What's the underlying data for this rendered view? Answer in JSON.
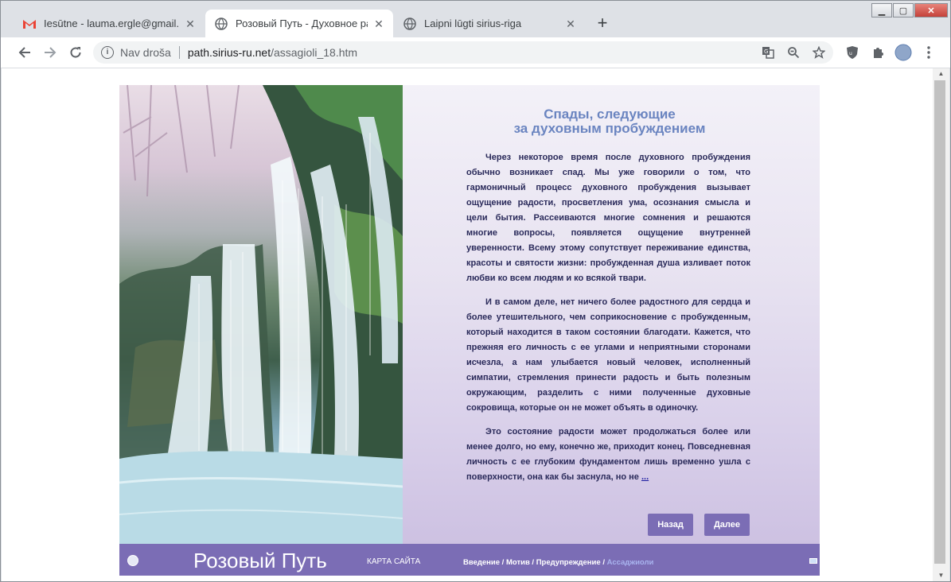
{
  "tabs": [
    {
      "title": "Iesūtne - lauma.ergle@gmail.com",
      "icon": "gmail-icon",
      "active": false
    },
    {
      "title": "Розовый Путь - Духовное разв",
      "icon": "globe-icon",
      "active": true
    },
    {
      "title": "Laipni lūgti sirius-riga",
      "icon": "globe-icon",
      "active": false
    }
  ],
  "omnibox": {
    "security": "Nav droša",
    "url_host": "path.sirius-ru.net",
    "url_path": "/assagioli_18.htm"
  },
  "article": {
    "heading_line1": "Спады, следующие",
    "heading_line2": "за духовным пробуждением",
    "para1": "Через некоторое время после духовного пробуждения обычно возникает спад. Мы уже говорили о том, что гармоничный процесс духовного пробуждения вызывает ощущение радости, просветления ума, осознания смысла и цели бытия. Рассеиваются многие сомнения и решаются многие вопросы, появляется ощущение внутренней уверенности. Всему этому сопутствует переживание единства, красоты и святости жизни: пробужденная душа изливает поток любви ко всем людям и ко всякой твари.",
    "para2": "И в самом деле, нет ничего более радостного для сердца и более утешительного, чем соприкосновение с пробужденным, который находится в таком состоянии благодати. Кажется, что прежняя его личность с ее углами и неприятными сторонами исчезла, а нам улыбается новый человек, исполненный симпатии, стремления принести радость и быть полезным окружающим, разделить с ними полученные духовные сокровища, которые он не может объять в одиночку.",
    "para3": "Это состояние радости может продолжаться более или менее долго, но ему, конечно же, приходит конец. Повседневная личность с ее глубоким фундаментом лишь временно ушла с поверхности, она как бы заснула, но не",
    "more": "...",
    "back_label": "Назад",
    "next_label": "Далее"
  },
  "footer": {
    "brand": "Розовый Путь",
    "sitemap": "КАРТА САЙТА",
    "crumb1": "Введение",
    "crumb2": "Мотив",
    "crumb3": "Предупреждение",
    "crumb4": "Ассаджиоли",
    "sep": " / "
  },
  "colors": {
    "accent": "#7b6db5",
    "heading": "#6a84c0",
    "body_text": "#2a2a5a"
  }
}
